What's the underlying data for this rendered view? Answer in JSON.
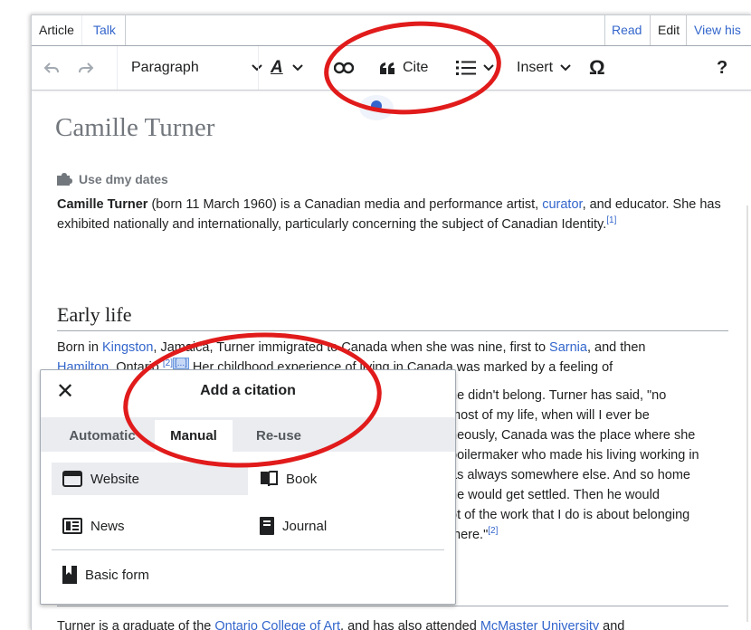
{
  "tabs": {
    "article": "Article",
    "talk": "Talk",
    "read": "Read",
    "edit": "Edit",
    "view_history": "View his"
  },
  "toolbar": {
    "paragraph": "Paragraph",
    "cite": "Cite",
    "insert": "Insert",
    "special_char": "Ω",
    "help": "?"
  },
  "article": {
    "title": "Camille Turner",
    "dmy_label": "Use dmy dates",
    "intro": {
      "bold_name": "Camille Turner",
      "text1": " (born 11 March 1960) is a Canadian media and performance artist, ",
      "link_curator": "curator",
      "text2": ", and educator. She has exhibited nationally and internationally, particularly concerning the subject of Canadian Identity.",
      "ref1": "[1]"
    },
    "section_early_life": "Early life",
    "early": {
      "line1_a": "Born in ",
      "link_kingston": "Kingston",
      "line1_b": ", Jamaica, Turner immigrated to Canada when she was nine, first to ",
      "link_sarnia": "Sarnia",
      "line1_c": ", and then",
      "link_hamilton": "Hamilton",
      "line2_a": ", Ontario.",
      "ref2": "[2]",
      "ref_ellipsis": "[...]",
      "line2_b": " Her childhood experience of living in Canada was marked by a feeling of"
    },
    "right_lines": [
      "he didn't belong. Turner has said, \"no",
      "most of my life, when will I ever be",
      "neously, Canada was the place where she",
      "boilermaker who made his living working in",
      "as always somewhere else. And so home",
      " he would get settled. Then he would",
      "ot of the work that I do is about belonging",
      "there.\""
    ],
    "ref2_end": "[2]",
    "bottom": {
      "text1": "Turner is a graduate of the ",
      "link_ocad": "Ontario College of Art",
      "text2": ", and has also attended ",
      "link_mcmaster": "McMaster University",
      "text3": " and"
    }
  },
  "citation_dialog": {
    "title": "Add a citation",
    "close_label": "✕",
    "tabs": [
      "Automatic",
      "Manual",
      "Re-use"
    ],
    "active_tab": "Manual",
    "options": {
      "website": "Website",
      "book": "Book",
      "news": "News",
      "journal": "Journal",
      "basic_form": "Basic form"
    }
  },
  "colors": {
    "link": "#3366cc",
    "annotation_red": "#e11b1b",
    "selection_bg": "#eaecf0"
  },
  "icons": [
    "undo-icon",
    "redo-icon",
    "text-style-icon",
    "link-icon",
    "cite-quote-icon",
    "list-icon",
    "puzzle-icon",
    "close-icon",
    "website-icon",
    "book-icon",
    "news-icon",
    "journal-icon",
    "basic-form-icon"
  ]
}
